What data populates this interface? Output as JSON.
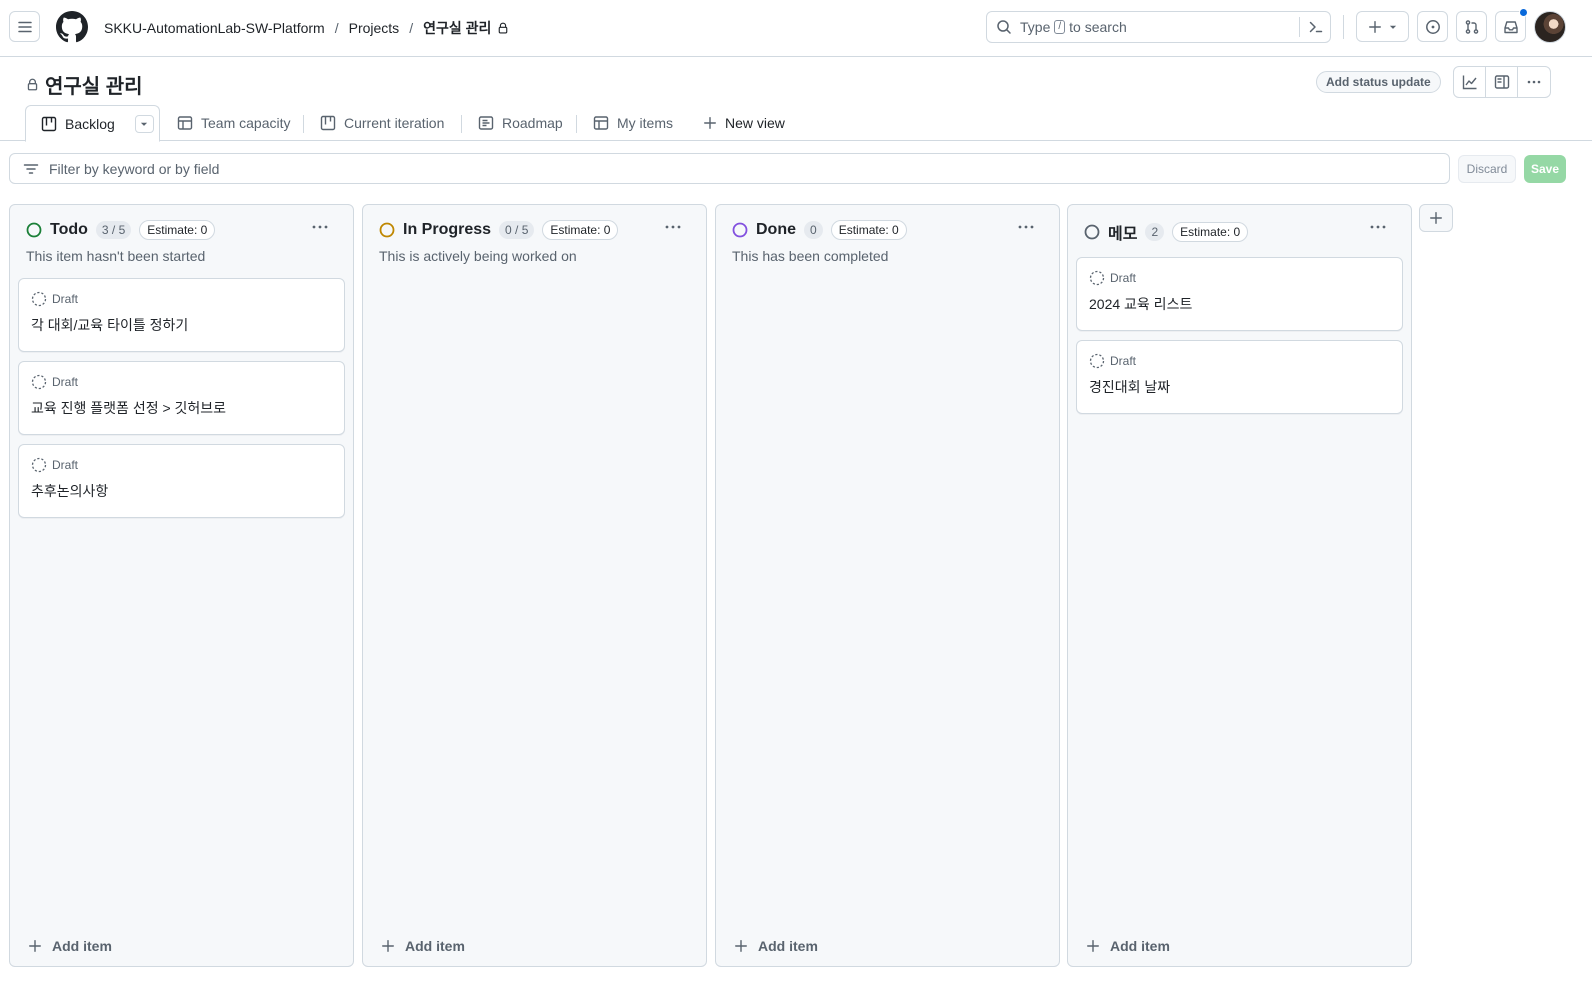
{
  "header": {
    "breadcrumb": {
      "org": "SKKU-AutomationLab-SW-Platform",
      "sep": "/",
      "projects": "Projects",
      "current": "연구실 관리"
    },
    "search": {
      "prefix": "Type",
      "key": "/",
      "suffix": "to search"
    }
  },
  "project": {
    "title": "연구실 관리",
    "status_button": "Add status update"
  },
  "tabs": [
    {
      "label": "Backlog",
      "icon": "board-icon",
      "active": true
    },
    {
      "label": "Team capacity",
      "icon": "table-icon"
    },
    {
      "label": "Current iteration",
      "icon": "board-icon"
    },
    {
      "label": "Roadmap",
      "icon": "roadmap-icon"
    },
    {
      "label": "My items",
      "icon": "table-icon"
    },
    {
      "label": "New view",
      "icon": "plus-icon"
    }
  ],
  "filter": {
    "placeholder": "Filter by keyword or by field",
    "discard": "Discard",
    "save": "Save"
  },
  "colors": {
    "todo": "#1a7f37",
    "in_progress": "#bf8700",
    "done": "#8250df",
    "memo": "#59636e"
  },
  "columns": [
    {
      "title": "Todo",
      "count": "3 / 5",
      "estimate": "Estimate: 0",
      "description": "This item hasn't been started",
      "cards": [
        {
          "status": "Draft",
          "title": "각 대회/교육 타이틀 정하기"
        },
        {
          "status": "Draft",
          "title": "교육 진행 플랫폼 선정 > 깃허브로"
        },
        {
          "status": "Draft",
          "title": "추후논의사항"
        }
      ],
      "add_item": "Add item"
    },
    {
      "title": "In Progress",
      "count": "0 / 5",
      "estimate": "Estimate: 0",
      "description": "This is actively being worked on",
      "cards": [],
      "add_item": "Add item"
    },
    {
      "title": "Done",
      "count": "0",
      "estimate": "Estimate: 0",
      "description": "This has been completed",
      "cards": [],
      "add_item": "Add item"
    },
    {
      "title": "메모",
      "count": "2",
      "estimate": "Estimate: 0",
      "description": "",
      "cards": [
        {
          "status": "Draft",
          "title": "2024 교육 리스트"
        },
        {
          "status": "Draft",
          "title": "경진대회 날짜"
        }
      ],
      "add_item": "Add item"
    }
  ]
}
